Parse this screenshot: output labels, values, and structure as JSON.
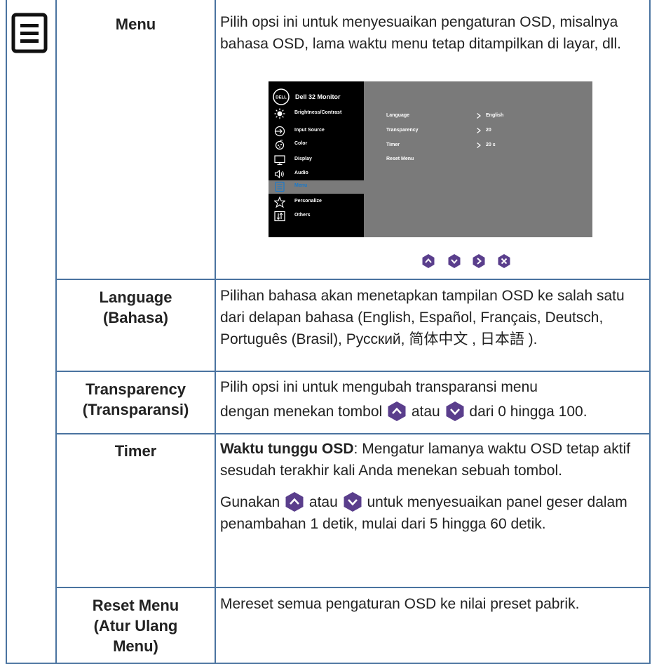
{
  "rows": {
    "menu": {
      "title": "Menu",
      "description": "Pilih opsi ini untuk menyesuaikan pengaturan OSD, misalnya bahasa OSD, lama waktu menu tetap ditampilkan di layar, dll."
    },
    "language": {
      "title_line1": "Language",
      "title_line2": "(Bahasa)",
      "description": "Pilihan bahasa akan menetapkan tampilan OSD ke salah satu dari delapan bahasa (English, Español, Français, Deutsch, Português (Brasil), Русский, 简体中文 , 日本語 )."
    },
    "transparency": {
      "title_line1": "Transparency",
      "title_line2": "(Transparansi)",
      "desc_line1": "Pilih opsi ini untuk mengubah transparansi menu",
      "desc_a": "dengan menekan tombol",
      "desc_b": "atau",
      "desc_c": "dari 0 hingga 100."
    },
    "timer": {
      "title": "Timer",
      "para1_bold": "Waktu tunggu OSD",
      "para1_rest": ": Mengatur lamanya waktu OSD tetap aktif sesudah terakhir kali Anda menekan sebuah tombol.",
      "para2_a": "Gunakan",
      "para2_b": "atau",
      "para2_c": "untuk menyesuaikan panel geser dalam penambahan 1 detik, mulai dari 5 hingga 60 detik."
    },
    "reset": {
      "title_line1": "Reset Menu",
      "title_line2": "(Atur Ulang",
      "title_line3": "Menu)",
      "description": "Mereset semua pengaturan OSD ke nilai preset pabrik."
    }
  },
  "osd": {
    "logo_text": "DELL",
    "model": "Dell 32 Monitor",
    "menu_items": [
      {
        "label": "Brightness/Contrast",
        "icon": "sun-icon"
      },
      {
        "label": "Input Source",
        "icon": "input-source-icon"
      },
      {
        "label": "Color",
        "icon": "color-icon"
      },
      {
        "label": "Display",
        "icon": "display-icon"
      },
      {
        "label": "Audio",
        "icon": "audio-icon"
      },
      {
        "label": "Menu",
        "icon": "menu-icon",
        "active": true
      },
      {
        "label": "Personalize",
        "icon": "star-icon"
      },
      {
        "label": "Others",
        "icon": "others-icon"
      }
    ],
    "settings": [
      {
        "label": "Language",
        "value": "English"
      },
      {
        "label": "Transparency",
        "value": "20"
      },
      {
        "label": "Timer",
        "value": "20 s"
      },
      {
        "label": "Reset Menu",
        "value": ""
      }
    ],
    "active_color": "#1b79c9"
  },
  "nav_buttons": [
    "up-button-icon",
    "down-button-icon",
    "right-button-icon",
    "close-button-icon"
  ],
  "colors": {
    "border": "#4a73a0",
    "button_fill": "#5a3e8c"
  }
}
